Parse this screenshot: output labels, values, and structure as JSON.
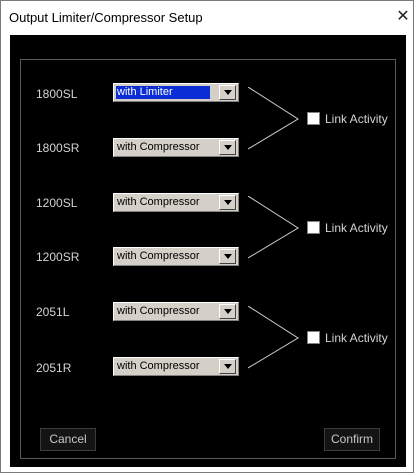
{
  "window": {
    "title": "Output Limiter/Compressor Setup",
    "close_glyph": "✕"
  },
  "groups": [
    {
      "channels": [
        {
          "label": "1800SL",
          "mode": "with Limiter",
          "selected": true
        },
        {
          "label": "1800SR",
          "mode": "with Compressor",
          "selected": false
        }
      ],
      "link": {
        "label": "Link Activity",
        "checked": false
      }
    },
    {
      "channels": [
        {
          "label": "1200SL",
          "mode": "with Compressor",
          "selected": false
        },
        {
          "label": "1200SR",
          "mode": "with Compressor",
          "selected": false
        }
      ],
      "link": {
        "label": "Link Activity",
        "checked": false
      }
    },
    {
      "channels": [
        {
          "label": "2051L",
          "mode": "with Compressor",
          "selected": false
        },
        {
          "label": "2051R",
          "mode": "with Compressor",
          "selected": false
        }
      ],
      "link": {
        "label": "Link Activity",
        "checked": false
      }
    }
  ],
  "buttons": {
    "cancel": "Cancel",
    "confirm": "Confirm"
  },
  "colors": {
    "panel_bg": "#000000",
    "selection": "#0a2dd6",
    "label_text": "#d4d4d4"
  }
}
